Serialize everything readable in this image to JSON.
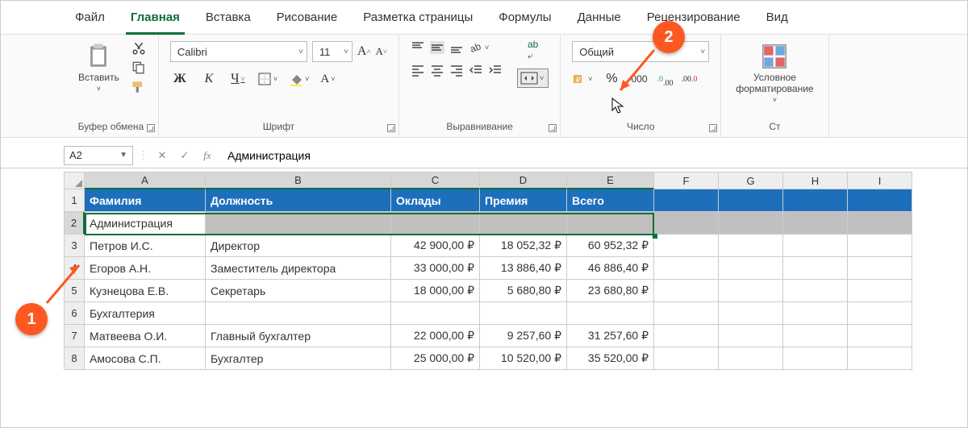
{
  "tabs": [
    "Файл",
    "Главная",
    "Вставка",
    "Рисование",
    "Разметка страницы",
    "Формулы",
    "Данные",
    "Рецензирование",
    "Вид"
  ],
  "active_tab": 1,
  "groups": {
    "clipboard": {
      "label": "Буфер обмена",
      "paste": "Вставить"
    },
    "font": {
      "label": "Шрифт",
      "name": "Calibri",
      "size": "11",
      "bold": "Ж",
      "italic": "К",
      "underline": "Ч"
    },
    "align": {
      "label": "Выравнивание",
      "wrap": "ab"
    },
    "number": {
      "label": "Число",
      "format": "Общий"
    },
    "condfmt": {
      "label": "Условное\nформатирование",
      "btn": "Условное форматирование"
    },
    "styles_short": "Ст"
  },
  "namebox": "A2",
  "formula": "Администрация",
  "cols": [
    "A",
    "B",
    "C",
    "D",
    "E",
    "F",
    "G",
    "H",
    "I"
  ],
  "selected_cols": [
    "A",
    "B",
    "C",
    "D",
    "E"
  ],
  "selected_row": 2,
  "col_widths": {
    "A": 150,
    "B": 230,
    "C": 110,
    "D": 108,
    "E": 108,
    "F": 80,
    "G": 80,
    "H": 80,
    "I": 80
  },
  "hdr": [
    "Фамилия",
    "Должность",
    "Оклады",
    "Премия",
    "Всего"
  ],
  "rows": [
    {
      "n": 2,
      "c": [
        "Администрация",
        "",
        "",
        "",
        ""
      ]
    },
    {
      "n": 3,
      "c": [
        "Петров И.С.",
        "Директор",
        "42 900,00 ₽",
        "18 052,32 ₽",
        "60 952,32 ₽"
      ]
    },
    {
      "n": 4,
      "c": [
        "Егоров А.Н.",
        "Заместитель директора",
        "33 000,00 ₽",
        "13 886,40 ₽",
        "46 886,40 ₽"
      ]
    },
    {
      "n": 5,
      "c": [
        "Кузнецова Е.В.",
        "Секретарь",
        "18 000,00 ₽",
        "5 680,80 ₽",
        "23 680,80 ₽"
      ]
    },
    {
      "n": 6,
      "c": [
        "Бухгалтерия",
        "",
        "",
        "",
        ""
      ]
    },
    {
      "n": 7,
      "c": [
        "Матвеева О.И.",
        "Главный бухгалтер",
        "22 000,00 ₽",
        "9 257,60 ₽",
        "31 257,60 ₽"
      ]
    },
    {
      "n": 8,
      "c": [
        "Амосова С.П.",
        "Бухгалтер",
        "25 000,00 ₽",
        "10 520,00 ₽",
        "35 520,00 ₽"
      ]
    }
  ],
  "callouts": {
    "1": "1",
    "2": "2"
  }
}
